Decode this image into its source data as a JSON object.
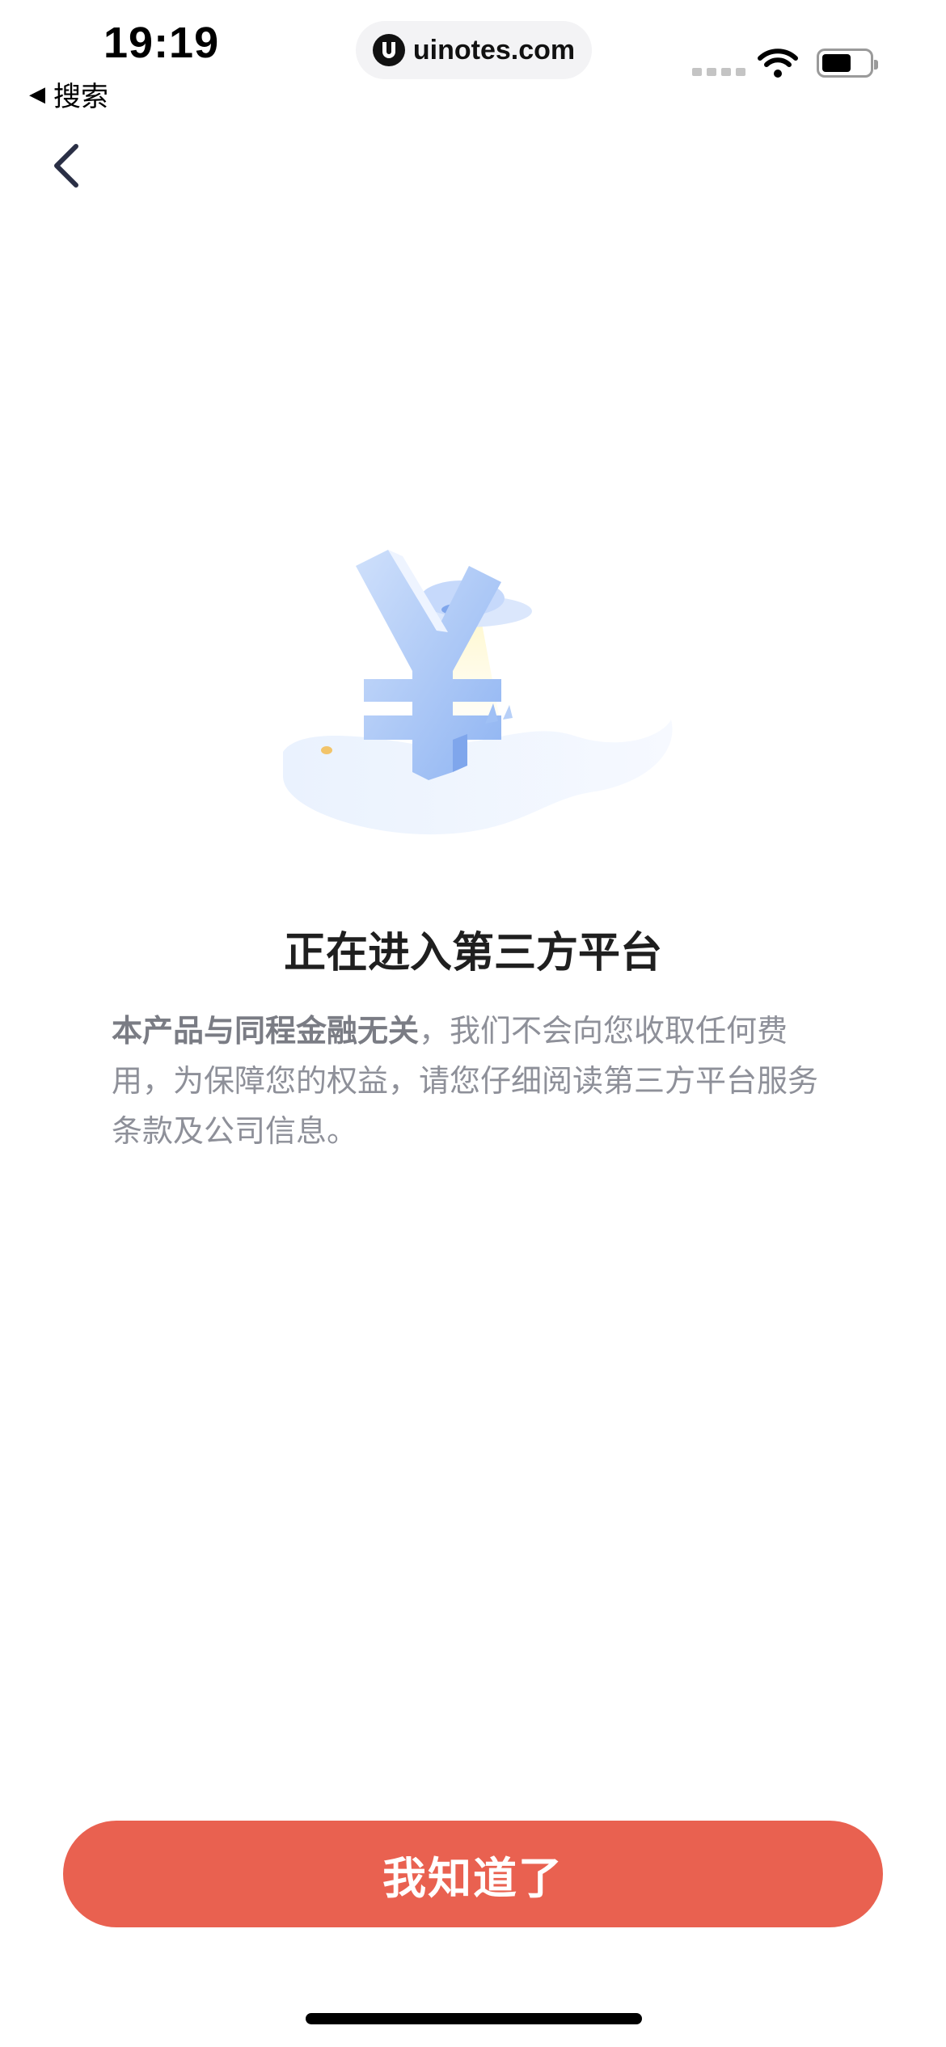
{
  "status_bar": {
    "time": "19:19",
    "back_app_label": "搜索",
    "url": "uinotes.com"
  },
  "notice": {
    "title": "正在进入第三方平台",
    "desc_bold": "本产品与同程金融无关",
    "desc_rest": "，我们不会向您收取任何费用，为保障您的权益，请您仔细阅读第三方平台服务条款及公司信息。"
  },
  "actions": {
    "confirm_label": "我知道了"
  },
  "colors": {
    "accent": "#e96150",
    "title": "#1f1f1f",
    "body_text": "#8e9099",
    "illustration_blue": "#8fb4f2"
  },
  "icons": {
    "nav_back": "chevron-left-icon",
    "illustration": "yuan-ufo-illustration"
  }
}
